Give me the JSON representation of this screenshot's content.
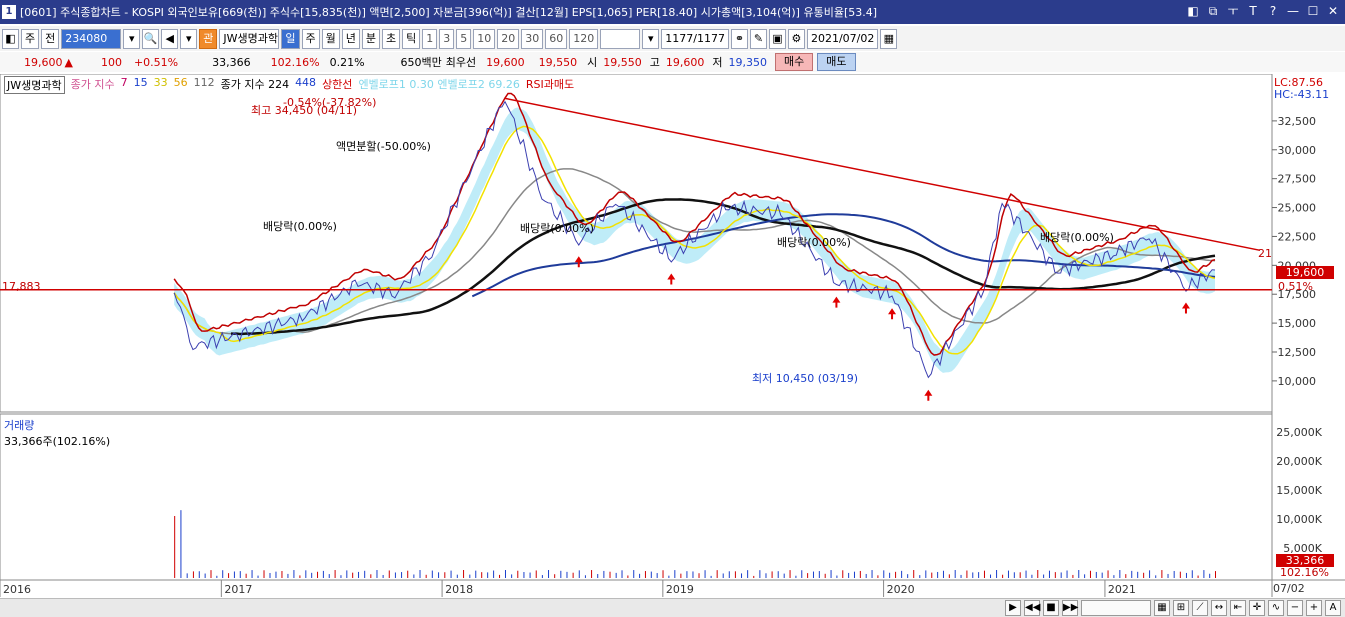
{
  "titlebar": {
    "app_number": "1",
    "title": "[0601] 주식종합차트 - KOSPI 외국인보유[669(천)] 주식수[15,835(천)] 액면[2,500] 자본금[396(억)] 결산[12월] EPS[1,065] PER[18.40] 시가총액[3,104(억)] 유통비율[53.4]",
    "buttons": [
      "◧",
      "⧉",
      "ㅜ",
      "T",
      "?",
      "—",
      "☐",
      "✕"
    ]
  },
  "toolbar": {
    "type_label": "주",
    "prev_label": "전",
    "code": "234080",
    "badge": "관",
    "stock_name": "JW생명과학",
    "periods": [
      "일",
      "주",
      "월",
      "년",
      "분",
      "초",
      "틱"
    ],
    "active_period": "일",
    "intervals": [
      "1",
      "3",
      "5",
      "10",
      "20",
      "30",
      "60",
      "120"
    ],
    "count": "1177/1177",
    "date": "2021/07/02"
  },
  "quote": {
    "price": "19,600",
    "change": "100",
    "change_pct": "+0.51%",
    "volume": "33,366",
    "volume_ratio": "102.16%",
    "turnover": "0.21%",
    "amount": "650백만",
    "bid_label": "최우선",
    "bid1": "19,600",
    "bid2": "19,550",
    "open_label": "시",
    "open": "19,550",
    "high_label": "고",
    "high": "19,600",
    "low_label": "저",
    "low": "19,350",
    "buy_label": "매수",
    "sell_label": "매도"
  },
  "legend": {
    "stock": "JW생명과학",
    "ma_label": "종가 지수",
    "ma_periods": [
      "7",
      "15",
      "33",
      "56",
      "112"
    ],
    "ma2_label": "종가 지수 224",
    "ma2_extra": "448",
    "upper": "상한선",
    "envelope": "엔벨로프1 0.30 엔벨로프2 69.26",
    "rsi": "RSI과매도",
    "lc": "LC:87.56",
    "hc": "HC:-43.11"
  },
  "annotations": {
    "high_label": "최고 34,450 (04/11)",
    "high_pct": "-0.54%(-37.82%)",
    "split_label": "액면분할(-50.00%)",
    "div1": "배당락(0.00%)",
    "div2": "배당락(0.00%)",
    "div3": "배당락(0.00%)",
    "div4": "배당락(0.00%)",
    "low_label": "최저 10,450 (03/19)",
    "support_value": "17,883",
    "trend_end": "21"
  },
  "price_axis": {
    "ticks": [
      "32,500",
      "30,000",
      "27,500",
      "25,000",
      "22,500",
      "20,000",
      "17,500",
      "15,000",
      "12,500",
      "10,000"
    ],
    "current": "19,600",
    "current_pct": "0.51%"
  },
  "volume": {
    "label": "거래량",
    "value": "33,366주(102.16%)",
    "ticks": [
      "25,000K",
      "20,000K",
      "15,000K",
      "10,000K",
      "5,000K"
    ],
    "current": "33,366",
    "current_pct": "102.16%"
  },
  "time_axis": {
    "labels": [
      "2016",
      "2017",
      "2018",
      "2019",
      "2020",
      "2021"
    ],
    "end": "07/02"
  },
  "chart_data": {
    "type": "line",
    "title": "JW생명과학",
    "x_start": "2016",
    "x_end": "2021/07/02",
    "ylim": [
      8000,
      35000
    ],
    "support_line": 17883,
    "price_series": [
      {
        "date": "2016-10",
        "close": 17883
      },
      {
        "date": "2016-11",
        "close": 13000
      },
      {
        "date": "2017-02",
        "close": 14200
      },
      {
        "date": "2017-05",
        "close": 15500
      },
      {
        "date": "2017-08",
        "close": 18500
      },
      {
        "date": "2017-10",
        "close": 17500
      },
      {
        "date": "2017-12",
        "close": 21000
      },
      {
        "date": "2018-02",
        "close": 28000
      },
      {
        "date": "2018-04",
        "close": 34450
      },
      {
        "date": "2018-06",
        "close": 26000
      },
      {
        "date": "2018-08",
        "close": 22000
      },
      {
        "date": "2018-10",
        "close": 25500
      },
      {
        "date": "2019-01",
        "close": 20500
      },
      {
        "date": "2019-04",
        "close": 25000
      },
      {
        "date": "2019-07",
        "close": 24500
      },
      {
        "date": "2019-10",
        "close": 18500
      },
      {
        "date": "2020-01",
        "close": 17500
      },
      {
        "date": "2020-03",
        "close": 10450
      },
      {
        "date": "2020-06",
        "close": 18000
      },
      {
        "date": "2020-07",
        "close": 25500
      },
      {
        "date": "2020-10",
        "close": 19500
      },
      {
        "date": "2021-01",
        "close": 21000
      },
      {
        "date": "2021-03",
        "close": 22500
      },
      {
        "date": "2021-05",
        "close": 18000
      },
      {
        "date": "2021-07-02",
        "close": 19600
      }
    ]
  }
}
